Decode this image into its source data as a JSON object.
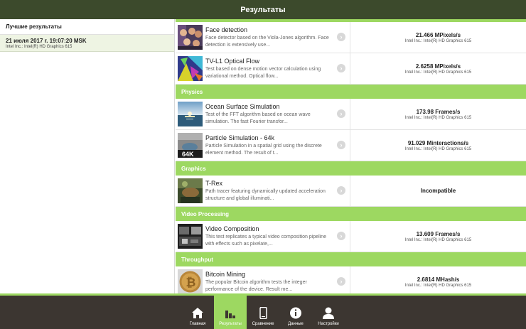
{
  "header": {
    "title": "Результаты"
  },
  "sidebar": {
    "heading": "Лучшие результаты",
    "items": [
      {
        "date": "21 июля 2017 г. 19:07:20 MSK",
        "device": "Intel Inc.: Intel(R) HD Graphics 615"
      }
    ]
  },
  "rows": [
    {
      "name": "Face detection",
      "desc": "Face detector based on the Viola-Jones algorithm. Face detection is extensively use...",
      "score": "21.466 MPixels/s",
      "device": "Intel Inc.: Intel(R) HD Graphics 615"
    },
    {
      "name": "TV-L1 Optical Flow",
      "desc": "Test based on dense motion vector calculation using variational method. Optical flow...",
      "score": "2.6258 MPixels/s",
      "device": "Intel Inc.: Intel(R) HD Graphics 615"
    },
    {
      "name": "Ocean Surface Simulation",
      "desc": "Test of the FFT algorithm based on ocean wave simulation. The fast Fourier transfor...",
      "score": "173.98 Frames/s",
      "device": "Intel Inc.: Intel(R) HD Graphics 615"
    },
    {
      "name": "Particle Simulation - 64k",
      "desc": "Particle Simulation in a spatial grid using the discrete element method. The result of t...",
      "score": "91.029 Minteractions/s",
      "device": "Intel Inc.: Intel(R) HD Graphics 615",
      "thumb_label": "64K"
    },
    {
      "name": "T-Rex",
      "desc": "Path tracer featuring dynamically updated acceleration structure and global illuminati...",
      "score": "Incompatible",
      "device": ""
    },
    {
      "name": "Video Composition",
      "desc": "This test replicates a typical video composition pipeline with effects such as pixelate,...",
      "score": "13.609 Frames/s",
      "device": "Intel Inc.: Intel(R) HD Graphics 615"
    },
    {
      "name": "Bitcoin Mining",
      "desc": "The popular Bitcoin algorithm tests the integer performance of the device. Result me...",
      "score": "2.6814 MHash/s",
      "device": "Intel Inc.: Intel(R) HD Graphics 615"
    }
  ],
  "sections": {
    "physics": "Physics",
    "graphics": "Graphics",
    "video": "Video Processing",
    "throughput": "Throughput"
  },
  "tabs": [
    {
      "label": "Главная",
      "icon": "home-icon"
    },
    {
      "label": "Результаты",
      "icon": "bar-chart-icon",
      "active": true
    },
    {
      "label": "Сравнение",
      "icon": "phone-icon"
    },
    {
      "label": "Данные",
      "icon": "info-icon"
    },
    {
      "label": "Настройки",
      "icon": "user-icon"
    }
  ],
  "colors": {
    "accent": "#9dd861",
    "header": "#3c4a2c",
    "tabbar": "#3c3631"
  }
}
